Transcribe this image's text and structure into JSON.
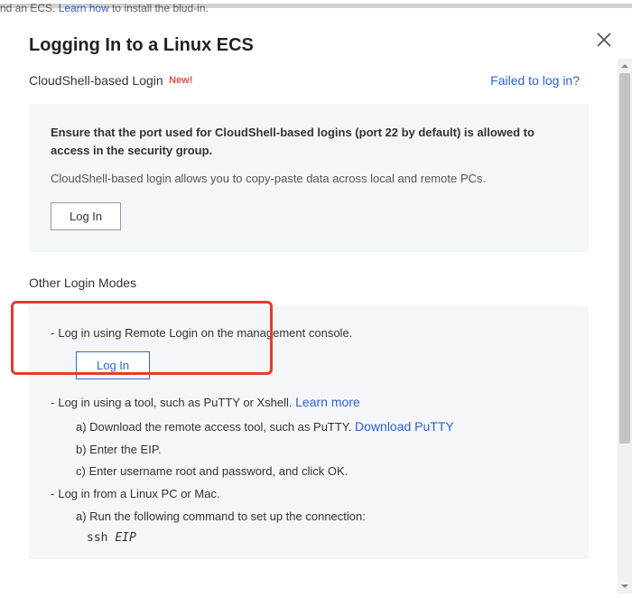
{
  "bg": {
    "prefix": "nd an ECS. ",
    "link": "Learn how",
    "suffix": " to install the blud-in."
  },
  "modal": {
    "title": "Logging In to a Linux ECS",
    "cloudshell_label": "CloudShell-based Login",
    "new_badge": "New!",
    "failed_link": "Failed to log in?",
    "panel_strong": "Ensure that the port used for CloudShell-based logins (port 22 by default) is allowed to access in the security group.",
    "panel_text": "CloudShell-based login allows you to copy-paste data across local and remote PCs.",
    "login_btn": "Log In",
    "other_title": "Other Login Modes",
    "m1": "Log in using Remote Login on the management console.",
    "m1_login": "Log In",
    "m2_prefix": "Log in using a tool, such as PuTTY or Xshell. ",
    "m2_link": "Learn more",
    "m2_a": "a) Download the remote access tool, such as PuTTY.  ",
    "m2_a_link": "Download PuTTY",
    "m2_b": "b) Enter the EIP.",
    "m2_c": "c) Enter username root and password, and click OK.",
    "m3": "Log in from a Linux PC or Mac.",
    "m3_a": "a) Run the following command to set up the connection:",
    "m3_cmd_prefix": "ssh ",
    "m3_cmd_italic": "EIP"
  }
}
